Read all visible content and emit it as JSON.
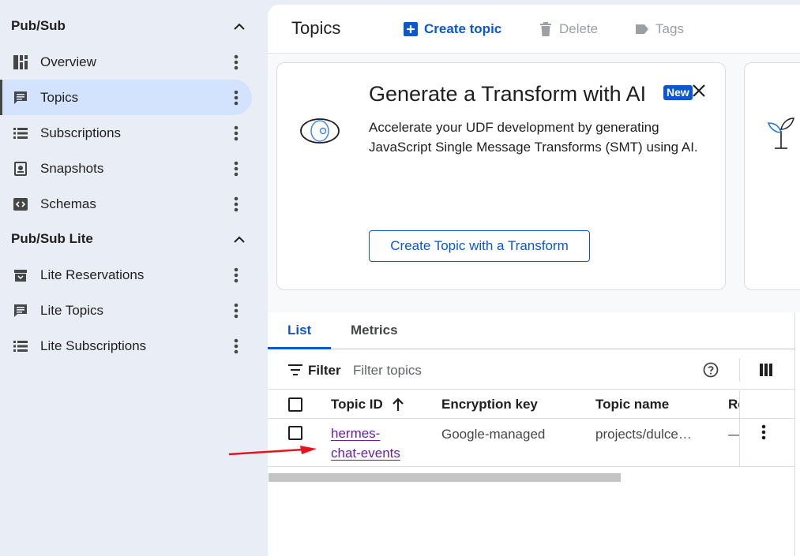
{
  "sidebar": {
    "section1": {
      "title": "Pub/Sub"
    },
    "section2": {
      "title": "Pub/Sub Lite"
    },
    "items": [
      {
        "label": "Overview",
        "icon": "dashboard-icon"
      },
      {
        "label": "Topics",
        "icon": "topic-icon",
        "active": true
      },
      {
        "label": "Subscriptions",
        "icon": "list-icon"
      },
      {
        "label": "Snapshots",
        "icon": "snapshot-icon"
      },
      {
        "label": "Schemas",
        "icon": "schema-icon"
      },
      {
        "label": "Lite Reservations",
        "icon": "reservation-icon"
      },
      {
        "label": "Lite Topics",
        "icon": "topic-icon"
      },
      {
        "label": "Lite Subscriptions",
        "icon": "list-icon"
      }
    ]
  },
  "toolbar": {
    "title": "Topics",
    "create_label": "Create topic",
    "delete_label": "Delete",
    "tags_label": "Tags"
  },
  "banner": {
    "title": "Generate a Transform with AI",
    "badge": "New",
    "description": "Accelerate your UDF development by generating JavaScript Single Message Transforms (SMT) using AI.",
    "button_label": "Create Topic with a Transform"
  },
  "tabs": {
    "list": "List",
    "metrics": "Metrics"
  },
  "filter": {
    "label": "Filter",
    "placeholder": "Filter topics"
  },
  "table": {
    "columns": [
      "Topic ID",
      "Encryption key",
      "Topic name",
      "Re"
    ],
    "rows": [
      {
        "topic_id": "hermes-chat-events",
        "topic_id_line1": "hermes-",
        "topic_id_line2": "chat-events",
        "encryption_key": "Google-managed",
        "topic_name": "projects/dulce…",
        "retention": "—"
      }
    ]
  },
  "colors": {
    "accent": "#0b57d0",
    "link_visited": "#681da8",
    "sidebar_bg": "#e9eef6",
    "active_bg": "#d3e3fd",
    "annotation_arrow": "#e8141b"
  }
}
